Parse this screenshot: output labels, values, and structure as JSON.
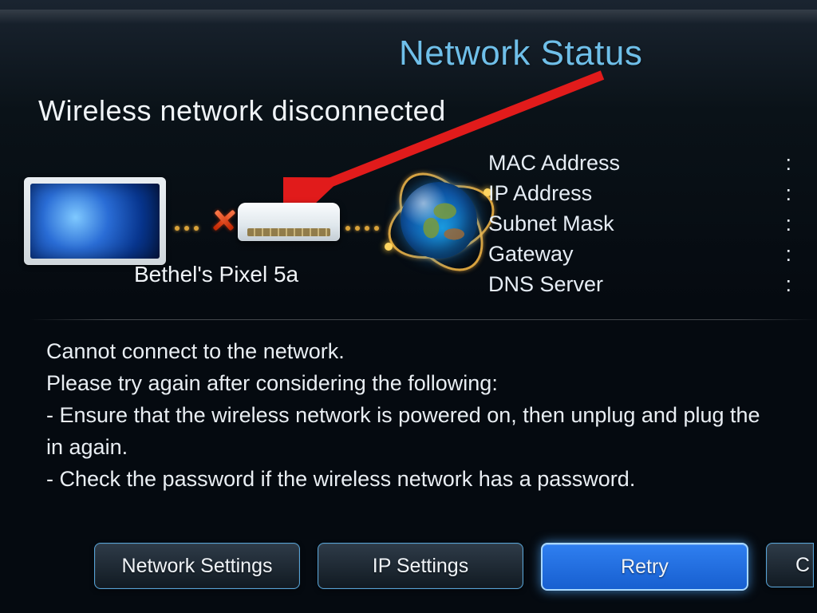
{
  "annotation": {
    "title": "Network Status"
  },
  "heading": "Wireless network disconnected",
  "diagram": {
    "router_label": "Bethel's Pixel 5a",
    "connection_tv_router": "disconnected",
    "connection_router_internet": "connected"
  },
  "info": {
    "rows": [
      {
        "label": "MAC Address",
        "value": ":"
      },
      {
        "label": "IP Address",
        "value": ":"
      },
      {
        "label": "Subnet Mask",
        "value": ":"
      },
      {
        "label": "Gateway",
        "value": ":"
      },
      {
        "label": "DNS Server",
        "value": ":"
      }
    ]
  },
  "message": "Cannot connect to the network.\nPlease try again after considering the following:\n- Ensure that the wireless network is powered on, then unplug and plug the \nin again.\n- Check the password if the wireless network has a password.",
  "buttons": {
    "network_settings": "Network Settings",
    "ip_settings": "IP Settings",
    "retry": "Retry",
    "close_partial": "C"
  },
  "selected_button": "retry",
  "colors": {
    "annotation_text": "#6fbfe9",
    "arrow": "#e11b1b",
    "accent_button": "#2f7ff0"
  }
}
